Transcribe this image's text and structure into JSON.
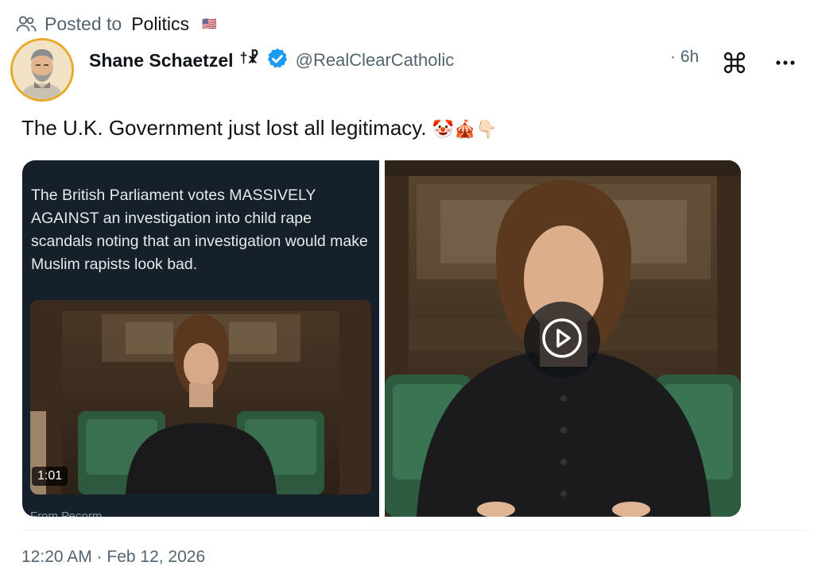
{
  "posted": {
    "label": "Posted to",
    "community": "Politics",
    "flag": "🇺🇸",
    "icon": "community-icon"
  },
  "author": {
    "name": "Shane Schaetzel",
    "suffix": "†☧",
    "handle": "@RealClearCatholic",
    "verified": true,
    "avatar_ring_color": "#e8a92c"
  },
  "meta": {
    "relative_time": "· 6h",
    "grok_icon": "grok-icon",
    "more_icon": "more-icon"
  },
  "post": {
    "text": "The U.K. Government just lost all legitimacy.",
    "emojis": "🤡🎪👇🏻"
  },
  "media": {
    "screenshot_text": "The British Parliament votes MASSIVELY AGAINST an investigation into child rape scandals noting that an investigation would make Muslim rapists look bad.",
    "video_duration": "1:01",
    "from_label": "From Ресоrm",
    "play_icon": "play-icon"
  },
  "footer": {
    "timestamp": "12:20 AM · Feb 12, 2026"
  },
  "colors": {
    "verified_blue": "#1d9bf0",
    "secondary_text": "#536471",
    "primary_text": "#0f1419"
  }
}
